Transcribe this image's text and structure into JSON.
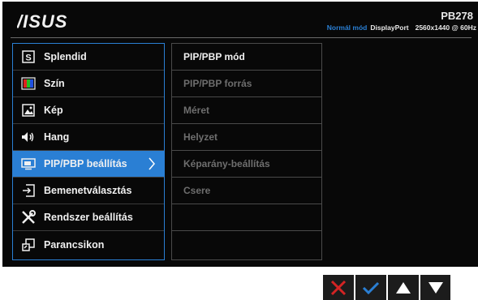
{
  "header": {
    "brand": "ASUS",
    "model": "PB278",
    "mode": "Normál mód",
    "source": "DisplayPort",
    "resolution": "2560x1440 @ 60Hz"
  },
  "menu": [
    {
      "label": "Splendid",
      "icon": "splendid-icon"
    },
    {
      "label": "Szín",
      "icon": "color-icon"
    },
    {
      "label": "Kép",
      "icon": "image-icon"
    },
    {
      "label": "Hang",
      "icon": "speaker-icon"
    },
    {
      "label": "PIP/PBP beállítás",
      "icon": "pip-icon",
      "selected": true
    },
    {
      "label": "Bemenetválasztás",
      "icon": "input-icon"
    },
    {
      "label": "Rendszer beállítás",
      "icon": "wrench-icon"
    },
    {
      "label": "Parancsikon",
      "icon": "shortcut-icon"
    }
  ],
  "submenu": [
    {
      "label": "PIP/PBP mód",
      "enabled": true
    },
    {
      "label": "PIP/PBP forrás",
      "enabled": false
    },
    {
      "label": "Méret",
      "enabled": false
    },
    {
      "label": "Helyzet",
      "enabled": false
    },
    {
      "label": "Képarány-beállítás",
      "enabled": false
    },
    {
      "label": "Csere",
      "enabled": false
    },
    {
      "label": "",
      "enabled": false
    },
    {
      "label": "",
      "enabled": false
    }
  ],
  "buttons": [
    {
      "name": "cancel",
      "icon": "close-icon",
      "color": "#d42424"
    },
    {
      "name": "confirm",
      "icon": "check-icon",
      "color": "#2a7fd4"
    },
    {
      "name": "up",
      "icon": "up-arrow-icon",
      "color": "#ffffff"
    },
    {
      "name": "down",
      "icon": "down-arrow-icon",
      "color": "#ffffff"
    }
  ],
  "colors": {
    "accent": "#2a7fd4",
    "osd_bg": "#080808",
    "button_bg": "#1c1c1c"
  }
}
